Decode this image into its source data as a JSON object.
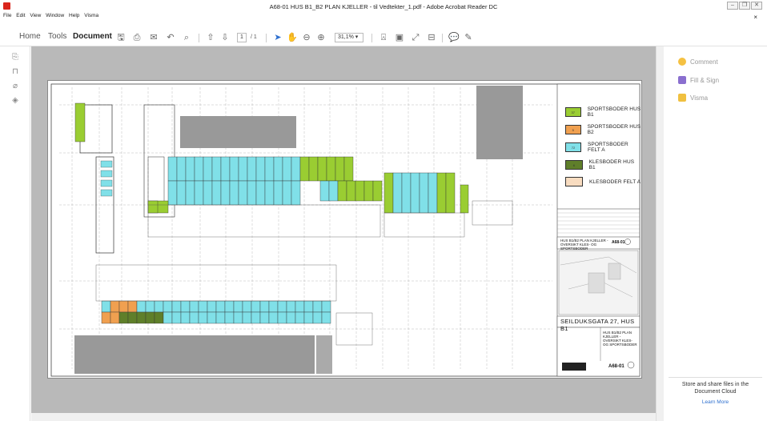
{
  "window": {
    "title": "A68-01 HUS B1_B2 PLAN KJELLER - til Vedtekter_1.pdf - Adobe Acrobat Reader DC",
    "controls": [
      "–",
      "❐",
      "✕"
    ]
  },
  "menu": [
    "File",
    "Edit",
    "View",
    "Window",
    "Help",
    "Visma"
  ],
  "tabs": [
    "Home",
    "Tools",
    "Document"
  ],
  "toolbar": {
    "page_current": "1",
    "page_total": "/ 1",
    "zoom": "31,1%"
  },
  "right_panel": {
    "items": [
      {
        "label": "Comment",
        "color": "#f5c142",
        "icon": "comment-icon"
      },
      {
        "label": "Fill & Sign",
        "color": "#8a6fcf",
        "icon": "fill-sign-icon"
      },
      {
        "label": "Visma",
        "color": "#f0c040",
        "icon": "folder-icon"
      }
    ],
    "store_text": "Store and share files in the Document Cloud",
    "learn_more": "Learn More"
  },
  "drawing": {
    "legend": [
      {
        "code": "37",
        "label": "SPORTSBODER  HUS B1",
        "color": "#9acd32"
      },
      {
        "code": "5",
        "label": "SPORTSBODER  HUS B2",
        "color": "#f0a050"
      },
      {
        "code": "72",
        "label": "SPORTSBODER  FELT A",
        "color": "#80e0e8"
      },
      {
        "code": "6",
        "label": "KLESBODER  HUS B1",
        "color": "#5f7f2a"
      },
      {
        "code": "",
        "label": "KLESBODER  FELT A",
        "color": "#f8dcc0"
      }
    ],
    "sheet_title": "HUS B1/B2 PLAN KJELLER - OVERSIKT KLES- OG SPORTSBODER",
    "sheet_no": "A68-01",
    "address": "SEILDUKSGATA 27, HUS B1",
    "drawing_label": "HUS B1/B2 PLAN KJELLER - OVERSIKT KLES- OG SPORTSBODER"
  }
}
